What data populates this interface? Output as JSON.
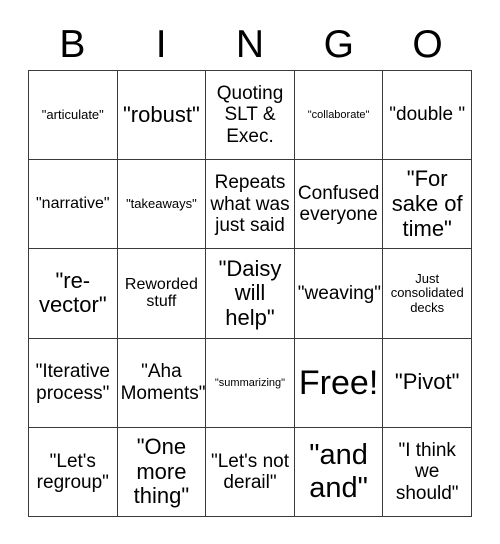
{
  "header": {
    "letters": [
      "B",
      "I",
      "N",
      "G",
      "O"
    ]
  },
  "grid": {
    "rows": 5,
    "columns": 5,
    "border_color": "#3a3a3a",
    "background_color": "#ffffff",
    "text_color": "#000000",
    "cells": [
      {
        "text": "\"articulate\"",
        "size": "sz-xs"
      },
      {
        "text": "\"robust\"",
        "size": "sz-lg"
      },
      {
        "text": "Quoting SLT & Exec.",
        "size": "sz-md"
      },
      {
        "text": "\"collaborate\"",
        "size": "sz-xxs"
      },
      {
        "text": "\"double \"",
        "size": "sz-md"
      },
      {
        "text": "\"narrative\"",
        "size": "sz-sm"
      },
      {
        "text": "\"takeaways\"",
        "size": "sz-xs"
      },
      {
        "text": "Repeats what was just said",
        "size": "sz-md"
      },
      {
        "text": "Confused everyone",
        "size": "sz-md"
      },
      {
        "text": "\"For sake of time\"",
        "size": "sz-lg"
      },
      {
        "text": "\"re-vector\"",
        "size": "sz-lg"
      },
      {
        "text": "Reworded stuff",
        "size": "sz-sm"
      },
      {
        "text": "\"Daisy will help\"",
        "size": "sz-lg"
      },
      {
        "text": "\"weaving\"",
        "size": "sz-md"
      },
      {
        "text": "Just consolidated decks",
        "size": "sz-xs"
      },
      {
        "text": "\"Iterative process\"",
        "size": "sz-md"
      },
      {
        "text": "\"Aha Moments\"",
        "size": "sz-md"
      },
      {
        "text": "\"summarizing\"",
        "size": "sz-xxs"
      },
      {
        "text": "Free!",
        "size": "sz-xxl"
      },
      {
        "text": "\"Pivot\"",
        "size": "sz-lg"
      },
      {
        "text": "\"Let's regroup\"",
        "size": "sz-md"
      },
      {
        "text": "\"One more thing\"",
        "size": "sz-lg"
      },
      {
        "text": "\"Let's not derail\"",
        "size": "sz-md"
      },
      {
        "text": "\"and and\"",
        "size": "sz-xl"
      },
      {
        "text": "\"I think we should\"",
        "size": "sz-md"
      }
    ]
  }
}
